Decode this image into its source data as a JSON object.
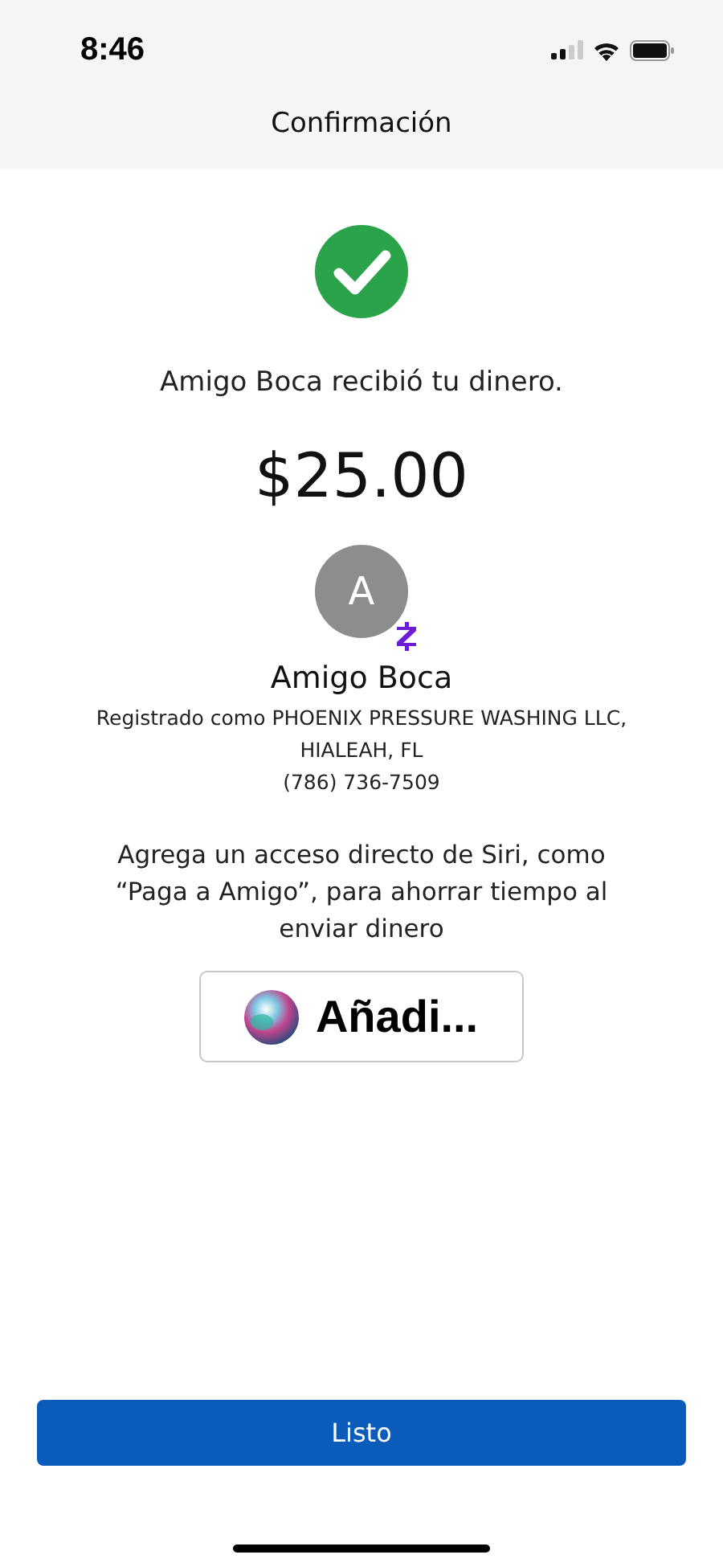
{
  "status_bar": {
    "time": "8:46"
  },
  "nav": {
    "title": "Confirmación"
  },
  "message": "Amigo Boca recibió tu dinero.",
  "amount": "$25.00",
  "recipient": {
    "initial": "A",
    "name": "Amigo Boca",
    "registered": "Registrado como PHOENIX PRESSURE WASHING LLC,",
    "location": "HIALEAH, FL",
    "phone": "(786) 736-7509"
  },
  "siri": {
    "text": "Agrega un acceso directo de Siri, como “Paga a Amigo”, para ahorrar tiempo al enviar dinero",
    "button": "Añadi..."
  },
  "done_button": "Listo"
}
